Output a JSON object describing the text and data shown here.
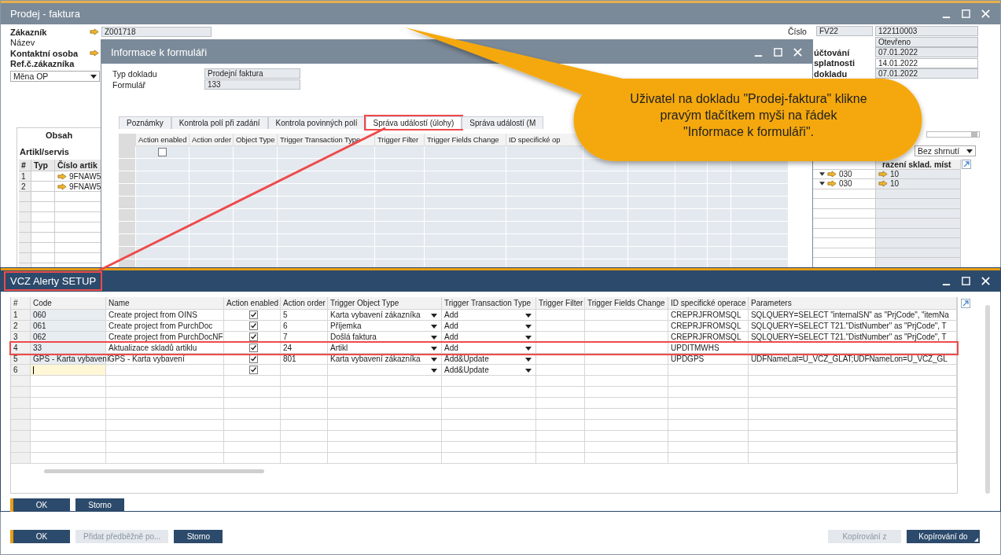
{
  "main_window": {
    "title": "Prodej - faktura",
    "header_left": [
      {
        "label": "Zákazník",
        "bold": true,
        "link": true,
        "value": "Z001718"
      },
      {
        "label": "Název",
        "bold": false,
        "link": false
      },
      {
        "label": "Kontaktní osoba",
        "bold": true,
        "link": true
      },
      {
        "label": "Ref.č.zákazníka",
        "bold": true,
        "link": false
      }
    ],
    "currency_dropdown": "Měna OP",
    "header_right": [
      {
        "label": "Číslo",
        "series": "FV22",
        "value": "122110003",
        "editable": false
      },
      {
        "value": "Otevřeno",
        "editable": false
      },
      {
        "label": "účtování",
        "value": "07.01.2022",
        "editable": false
      },
      {
        "label": "splatnosti",
        "value": "14.01.2022",
        "editable": true
      },
      {
        "label": "dokladu",
        "value": "07.01.2022",
        "editable": false
      }
    ],
    "tab": {
      "label": "Obsah",
      "selected": true
    },
    "section_title": "Artikl/servis",
    "items_table": {
      "columns": [
        "#",
        "Typ",
        "Číslo artik"
      ],
      "rows": [
        {
          "num": "1",
          "item": "9FNAW5"
        },
        {
          "num": "2",
          "item": "9FNAW5"
        }
      ]
    },
    "summary_dropdown": "Bez shrnutí",
    "right_table": {
      "header": "razení sklad. míst",
      "rows": [
        {
          "warehouse": "030",
          "value": "10"
        },
        {
          "warehouse": "030",
          "value": "10"
        }
      ]
    },
    "buttons": [
      {
        "label": "OK",
        "kind": "primary",
        "disabled": false
      },
      {
        "label": "Přidat předběžně po...",
        "kind": "secondary",
        "disabled": true
      },
      {
        "label": "Storno",
        "kind": "secondary",
        "disabled": false
      }
    ],
    "right_buttons": [
      {
        "label": "Kopírování z",
        "disabled": true,
        "dropdown": false
      },
      {
        "label": "Kopírování do",
        "disabled": false,
        "dropdown": true
      }
    ]
  },
  "form_info_window": {
    "title": "Informace k formuláři",
    "fields": [
      {
        "label": "Typ dokladu",
        "value": "Prodejní faktura"
      },
      {
        "label": "Formulář",
        "value": "133"
      }
    ],
    "tabs": [
      {
        "label": "Poznámky",
        "selected": false,
        "highlighted": false
      },
      {
        "label": "Kontrola polí při zadání",
        "selected": false,
        "highlighted": false
      },
      {
        "label": "Kontrola povinných polí",
        "selected": false,
        "highlighted": false
      },
      {
        "label": "Správa událostí (úlohy)",
        "selected": true,
        "highlighted": true
      },
      {
        "label": "Správa událostí (M",
        "selected": false,
        "highlighted": false
      }
    ],
    "grid": {
      "columns": [
        "Action enabled",
        "Action order",
        "Object Type",
        "Trigger Transaction Type",
        "Trigger Filter",
        "Trigger Fields Change",
        "ID specifické op"
      ],
      "rows": [
        {
          "action_enabled": false
        }
      ]
    }
  },
  "setup_window": {
    "title": "VCZ Alerty SETUP",
    "title_highlighted": true,
    "columns": [
      "#",
      "Code",
      "Name",
      "Action enabled",
      "Action order",
      "Trigger Object Type",
      "Trigger Transaction Type",
      "Trigger Filter",
      "Trigger Fields Change",
      "ID specifické operace",
      "Parameters"
    ],
    "rows": [
      {
        "num": "1",
        "code": "060",
        "name": "Create project from OINS",
        "action_enabled": true,
        "action_order": "5",
        "object_type": "Karta vybavení zákazníka",
        "transaction_type": "Add",
        "operation_id": "CREPRJFROMSQL",
        "parameters": "SQLQUERY=SELECT \"internalSN\" as \"PrjCode\", \"itemNa",
        "highlighted": false,
        "editing": false
      },
      {
        "num": "2",
        "code": "061",
        "name": "Create project from PurchDoc",
        "action_enabled": true,
        "action_order": "6",
        "object_type": "Příjemka",
        "transaction_type": "Add",
        "operation_id": "CREPRJFROMSQL",
        "parameters": "SQLQUERY=SELECT T21.\"DistNumber\" as \"PrjCode\", T",
        "highlighted": false,
        "editing": false
      },
      {
        "num": "3",
        "code": "062",
        "name": "Create project from PurchDocNF",
        "action_enabled": true,
        "action_order": "7",
        "object_type": "Došlá faktura",
        "transaction_type": "Add",
        "operation_id": "CREPRJFROMSQL",
        "parameters": "SQLQUERY=SELECT T21.\"DistNumber\" as \"PrjCode\", T",
        "highlighted": false,
        "editing": false
      },
      {
        "num": "4",
        "code": "33",
        "name": "Aktualizace skladů artiklu",
        "action_enabled": true,
        "action_order": "24",
        "object_type": "Artikl",
        "transaction_type": "Add",
        "operation_id": "UPDITMWHS",
        "highlighted": true,
        "editing": false
      },
      {
        "num": "5",
        "code": "GPS - Karta vybavení",
        "name": "GPS - Karta vybavení",
        "action_enabled": true,
        "action_order": "801",
        "object_type": "Karta vybavení zákazníka",
        "transaction_type": "Add&Update",
        "operation_id": "UPDGPS",
        "parameters": "UDFNameLat=U_VCZ_GLAT;UDFNameLon=U_VCZ_GL",
        "highlighted": false,
        "editing": false
      },
      {
        "num": "6",
        "action_enabled": true,
        "transaction_type": "Add&Update",
        "highlighted": false,
        "editing": true
      }
    ],
    "buttons": [
      {
        "label": "OK",
        "kind": "primary"
      },
      {
        "label": "Storno",
        "kind": "secondary"
      }
    ]
  },
  "callout": {
    "text": "Uživatel na dokladu \"Prodej-faktura\" klikne pravým tlačítkem myši na řádek \"Informace k formuláři\"."
  }
}
